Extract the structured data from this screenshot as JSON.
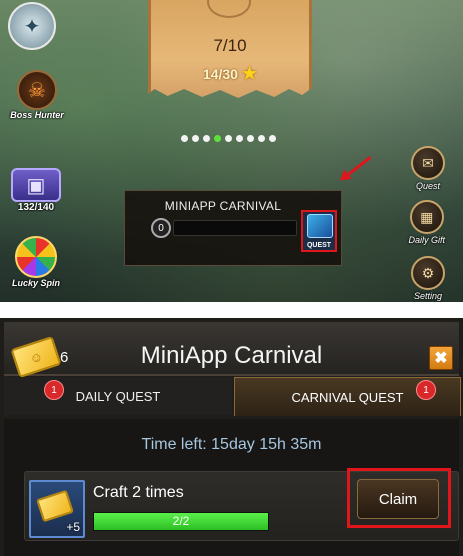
{
  "top": {
    "banner": {
      "progress_main": "7/10",
      "progress_stars": "14/30",
      "star_icon": "★"
    },
    "left_icons": [
      {
        "name": "emblem",
        "label": ""
      },
      {
        "name": "boss-hunter",
        "label": "Boss Hunter"
      },
      {
        "name": "chest",
        "label": "132/140"
      },
      {
        "name": "lucky-spin",
        "label": "Lucky Spin"
      }
    ],
    "page_dots": {
      "count": 9,
      "active_index": 3
    },
    "right_icons": [
      {
        "label": "Quest"
      },
      {
        "label": "Daily Gift"
      },
      {
        "label": "Setting"
      }
    ],
    "carnival_widget": {
      "title": "MINIAPP CARNIVAL",
      "count": "0",
      "quest_button_label": "QUEST"
    },
    "highlight_color": "#e0161b"
  },
  "bottom": {
    "ticket_count": "6",
    "title": "MiniApp Carnival",
    "close_icon": "✖",
    "tabs": [
      {
        "label": "DAILY QUEST",
        "badge": "1",
        "active": false
      },
      {
        "label": "CARNIVAL QUEST",
        "badge": "1",
        "active": true
      }
    ],
    "time_left": "Time left: 15day 15h 35m",
    "quest": {
      "name": "Craft 2 times",
      "reward_amount": "+5",
      "progress_text": "2/2",
      "progress_fraction": 1.0,
      "claim_label": "Claim"
    }
  }
}
